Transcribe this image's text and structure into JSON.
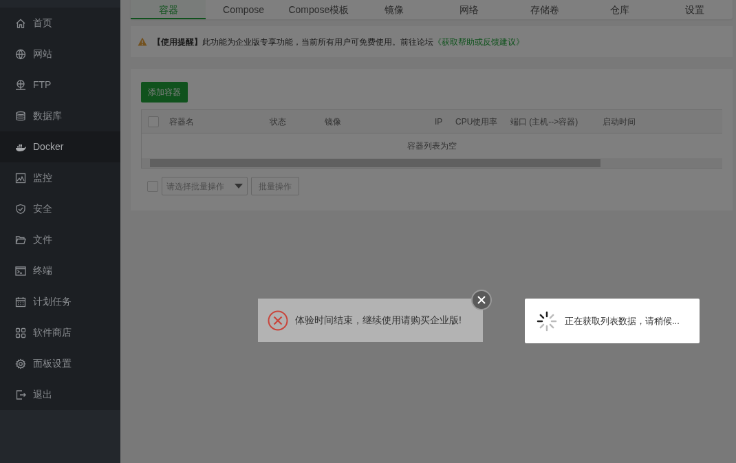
{
  "sidebar": {
    "items": [
      {
        "label": "首页",
        "selected": false
      },
      {
        "label": "网站",
        "selected": false
      },
      {
        "label": "FTP",
        "selected": false
      },
      {
        "label": "数据库",
        "selected": false
      },
      {
        "label": "Docker",
        "selected": true
      },
      {
        "label": "监控",
        "selected": false
      },
      {
        "label": "安全",
        "selected": false
      },
      {
        "label": "文件",
        "selected": false
      },
      {
        "label": "终端",
        "selected": false
      },
      {
        "label": "计划任务",
        "selected": false
      },
      {
        "label": "软件商店",
        "selected": false
      },
      {
        "label": "面板设置",
        "selected": false
      },
      {
        "label": "退出",
        "selected": false
      }
    ]
  },
  "tabs": [
    {
      "label": "容器",
      "selected": true
    },
    {
      "label": "Compose",
      "selected": false
    },
    {
      "label": "Compose模板",
      "selected": false
    },
    {
      "label": "镜像",
      "selected": false
    },
    {
      "label": "网络",
      "selected": false
    },
    {
      "label": "存储卷",
      "selected": false
    },
    {
      "label": "仓库",
      "selected": false
    },
    {
      "label": "设置",
      "selected": false
    }
  ],
  "notice": {
    "text": "**【使用提醒】**此功能为企业版专享功能，当前所有用户可免费使用。前往论坛",
    "link": "《获取帮助或反馈建议》"
  },
  "add_button": "添加容器",
  "table": {
    "select_all_checked": false,
    "columns": [
      "容器名",
      "状态",
      "镜像",
      "IP",
      "CPU使用率",
      "端口 (主机-->容器)",
      "启动时间"
    ],
    "empty_text": "容器列表为空"
  },
  "batch": {
    "checked": false,
    "placeholder": "请选择批量操作",
    "button": "批量操作"
  },
  "error_toast": {
    "text": "体验时间结束，继续使用请购买企业版!"
  },
  "loading": {
    "text": "正在获取列表数据，请稍候..."
  }
}
